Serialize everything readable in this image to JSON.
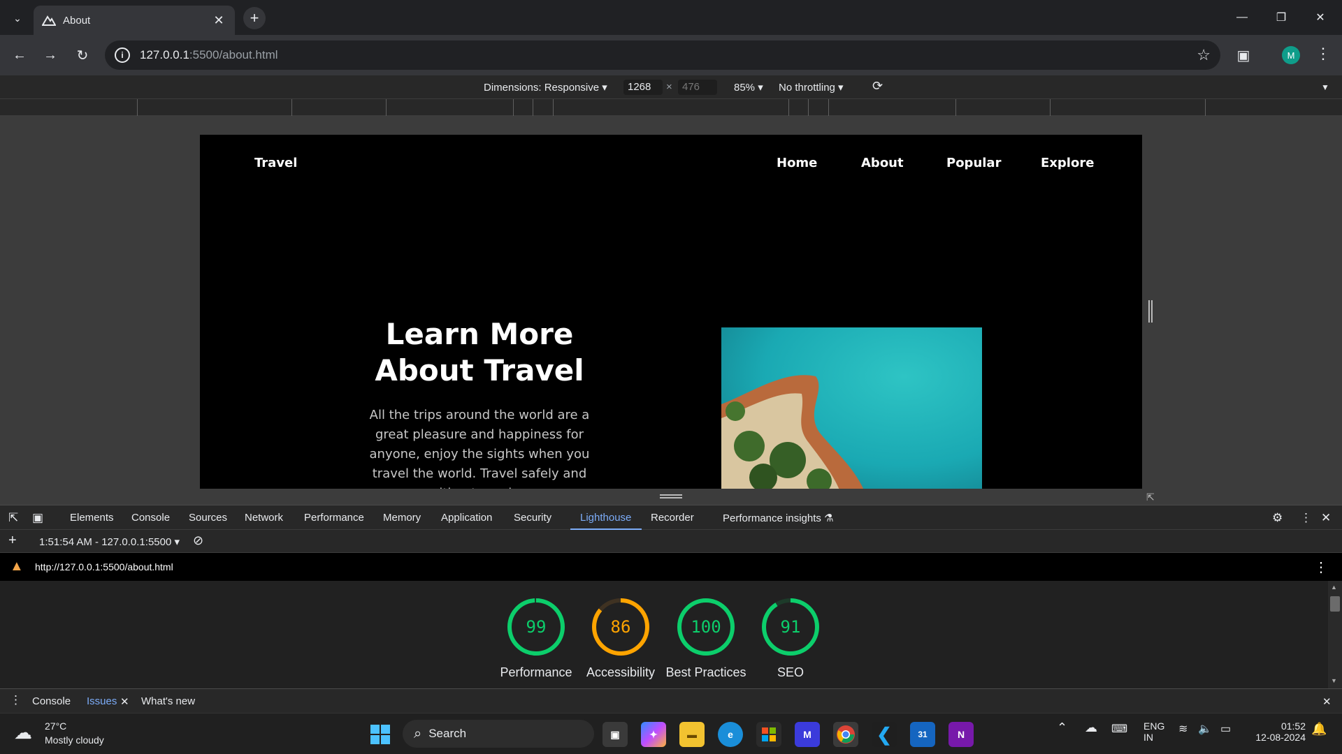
{
  "browser": {
    "tab_title": "About",
    "url_host": "127.0.0.1",
    "url_rest": ":5500/about.html",
    "avatar_letter": "M"
  },
  "device_toolbar": {
    "dimensions_label": "Dimensions: Responsive",
    "width_value": "1268",
    "height_value": "476",
    "times": "×",
    "zoom": "85%",
    "throttling": "No throttling"
  },
  "site": {
    "logo": "Travel",
    "nav": [
      "Home",
      "About",
      "Popular",
      "Explore"
    ],
    "heading_line1": "Learn More",
    "heading_line2": "About Travel",
    "paragraph": "All the trips around the world are a great pleasure and happiness for anyone, enjoy the sights when you travel the world. Travel safely and without worries,"
  },
  "devtools": {
    "tabs": [
      "Elements",
      "Console",
      "Sources",
      "Network",
      "Performance",
      "Memory",
      "Application",
      "Security",
      "Lighthouse",
      "Recorder",
      "Performance insights"
    ],
    "active_tab": "Lighthouse",
    "report_selector": "1:51:54 AM - 127.0.0.1:5500",
    "report_url": "http://127.0.0.1:5500/about.html",
    "scores": [
      {
        "label": "Performance",
        "value": 99,
        "color": "#0cce6b"
      },
      {
        "label": "Accessibility",
        "value": 86,
        "color": "#ffa400"
      },
      {
        "label": "Best Practices",
        "value": 100,
        "color": "#0cce6b"
      },
      {
        "label": "SEO",
        "value": 91,
        "color": "#0cce6b"
      }
    ],
    "drawer_tabs": [
      "Console",
      "Issues",
      "What's new"
    ]
  },
  "taskbar": {
    "weather_temp": "27°C",
    "weather_desc": "Mostly cloudy",
    "search_label": "Search",
    "lang_line1": "ENG",
    "lang_line2": "IN",
    "time": "01:52",
    "date": "12-08-2024"
  }
}
